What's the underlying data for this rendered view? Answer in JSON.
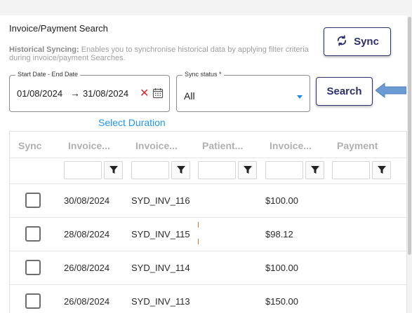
{
  "page": {
    "title": "Invoice/Payment Search",
    "description_bold": "Historical Syncing:",
    "description_rest": " Enables you to synchronise historical data by applying filter criteria during invoice/payment Searches."
  },
  "sync_button": {
    "label": "Sync",
    "icon": "sync-icon"
  },
  "date_range": {
    "legend": "Start Date - End Date",
    "start": "01/08/2024",
    "arrow": "→",
    "end": "31/08/2024",
    "clear_glyph": "✕",
    "calendar_icon": "calendar-icon"
  },
  "sync_status": {
    "legend": "Sync status *",
    "value": "All"
  },
  "search_button": {
    "label": "Search"
  },
  "select_duration": "Select Duration",
  "table": {
    "columns": [
      "Sync",
      "Invoice...",
      "Invoice...",
      "Patient...",
      "Invoice...",
      "Payment"
    ],
    "rows": [
      {
        "date": "30/08/2024",
        "invoice": "SYD_INV_116",
        "amount": "$100.00"
      },
      {
        "date": "28/08/2024",
        "invoice": "SYD_INV_115",
        "amount": "$98.12"
      },
      {
        "date": "26/08/2024",
        "invoice": "SYD_INV_114",
        "amount": "$100.00"
      },
      {
        "date": "26/08/2024",
        "invoice": "SYD_INV_113",
        "amount": "$150.00"
      }
    ]
  },
  "colors": {
    "accent": "#2b2f6b",
    "link": "#2196f3",
    "clear": "#d32f2f",
    "arrow": "#6b9bd2"
  }
}
